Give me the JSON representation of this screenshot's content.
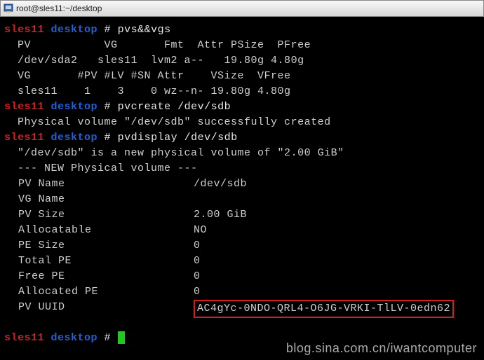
{
  "titlebar": {
    "text": "root@sles11:~/desktop"
  },
  "prompt": {
    "host": "sles11",
    "dir": "desktop",
    "hash": " # "
  },
  "cmd1": "pvs&&vgs",
  "pvs_header": "  PV           VG       Fmt  Attr PSize  PFree",
  "pvs_row": "  /dev/sda2   sles11  lvm2 a--   19.80g 4.80g",
  "vgs_header": "  VG       #PV #LV #SN Attr    VSize  VFree",
  "vgs_row": "  sles11    1    3    0 wz--n- 19.80g 4.80g",
  "cmd2": "pvcreate /dev/sdb",
  "pvcreate_out": "  Physical volume \"/dev/sdb\" successfully created",
  "cmd3": "pvdisplay /dev/sdb",
  "pvd_msg": "  \"/dev/sdb\" is a new physical volume of \"2.00 GiB\"",
  "pvd_hdr": "  --- NEW Physical volume ---",
  "fields": {
    "pv_name_k": "PV Name",
    "pv_name_v": "/dev/sdb",
    "vg_name_k": "VG Name",
    "vg_name_v": "",
    "pv_size_k": "PV Size",
    "pv_size_v": "2.00 GiB",
    "alloc_k": "Allocatable",
    "alloc_v": "NO",
    "pe_size_k": "PE Size",
    "pe_size_v": "0",
    "total_pe_k": "Total PE",
    "total_pe_v": "0",
    "free_pe_k": "Free PE",
    "free_pe_v": "0",
    "alloc_pe_k": "Allocated PE",
    "alloc_pe_v": "0",
    "uuid_k": "PV UUID",
    "uuid_v": "AC4gYc-0NDO-QRL4-O6JG-VRKI-TlLV-0edn62"
  },
  "watermark": "blog.sina.com.cn/iwantcomputer"
}
